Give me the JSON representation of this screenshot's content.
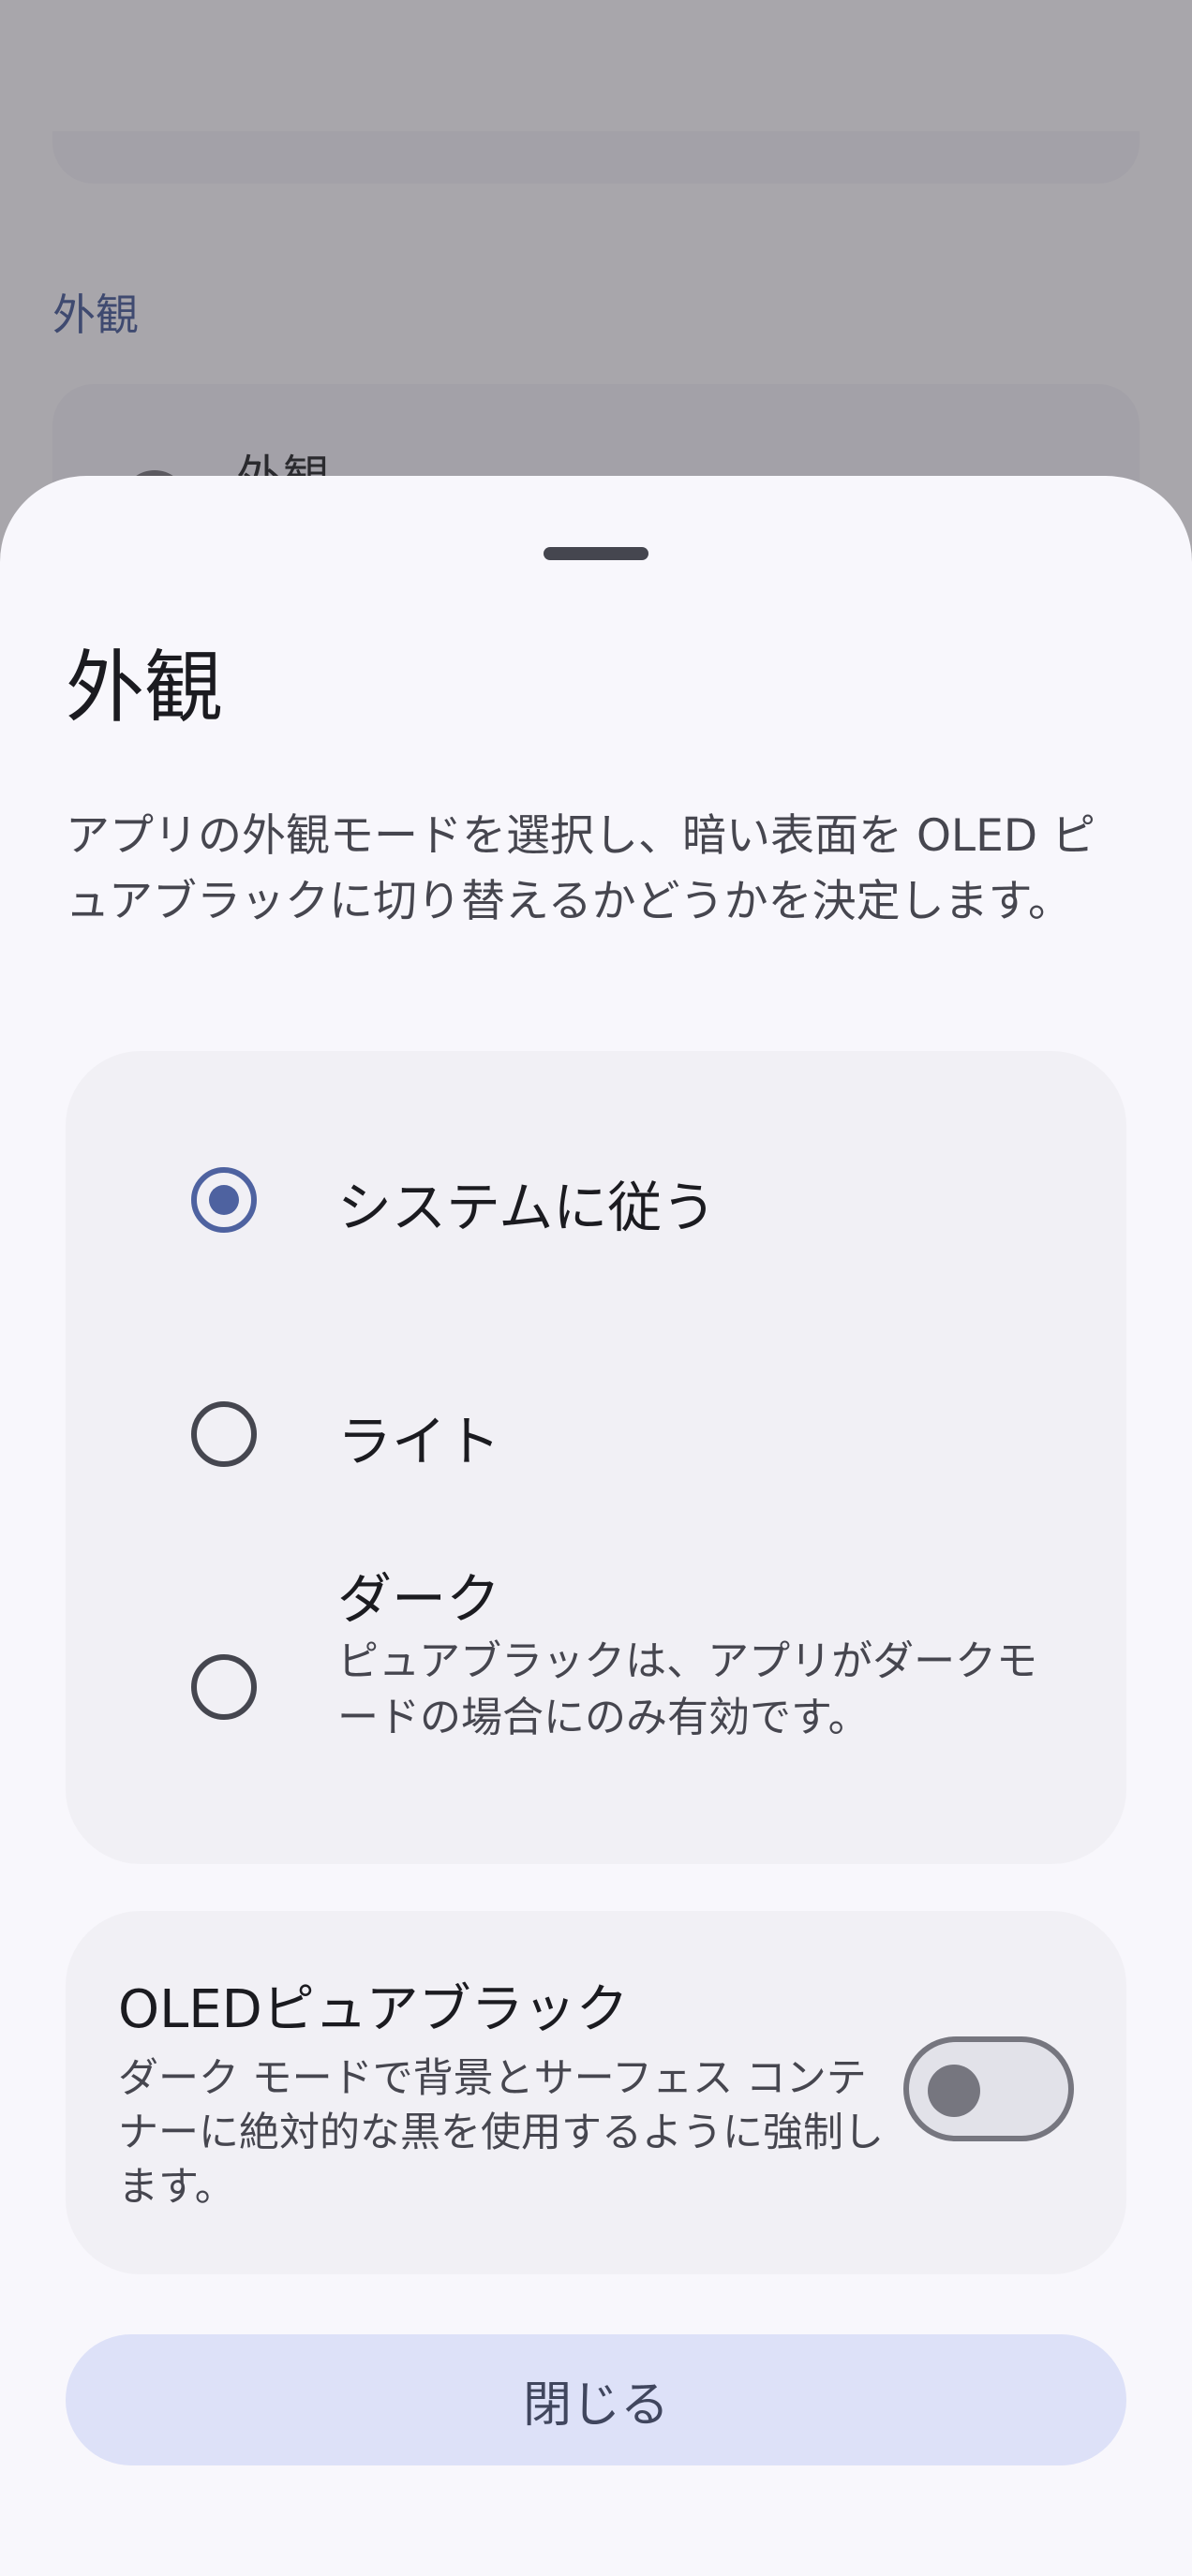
{
  "background_screen": {
    "section_title": "外観",
    "card_label": "外観"
  },
  "sheet": {
    "title": "外観",
    "description": "アプリの外観モードを選択し、暗い表面を OLED ピュアブラックに切り替えるかどうかを決定します。",
    "options": [
      {
        "label": "システムに従う",
        "selected": true
      },
      {
        "label": "ライト",
        "selected": false
      },
      {
        "label": "ダーク",
        "sublabel": "ピュアブラックは、アプリがダークモードの場合にのみ有効です。",
        "selected": false
      }
    ],
    "oled": {
      "title": "OLEDピュアブラック",
      "description": "ダーク モードで背景とサーフェス コンテナーに絶対的な黒を使用するように強制します。",
      "enabled": false
    },
    "close_label": "閉じる"
  },
  "colors": {
    "accent": "#4e62a0",
    "sheet_bg": "#f8f7fc",
    "card_bg": "#f1f0f5",
    "button_bg": "#dde1f8",
    "scrim": "#a8a6ab"
  }
}
